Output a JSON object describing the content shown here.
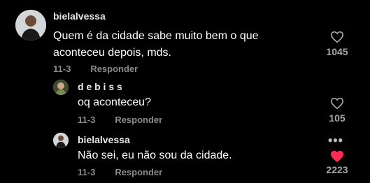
{
  "comments": [
    {
      "username": "bielalvessa",
      "text_line1": "Quem é da cidade sabe muito bem o que",
      "text_line2": "aconteceu depois, mds.",
      "date": "11-3",
      "reply_label": "Responder",
      "likes": "1045",
      "liked": false,
      "avatar_icon": "profile-photo"
    },
    {
      "username": "d e b i s s",
      "text_line1": "oq aconteceu?",
      "date": "11-3",
      "reply_label": "Responder",
      "likes": "105",
      "liked": false,
      "avatar_icon": "profile-photo"
    },
    {
      "username": "bielalvessa",
      "text_line1": "Não sei, eu não sou da cidade.",
      "date": "11-3",
      "reply_label": "Responder",
      "likes": "2223",
      "liked": true,
      "more_label": "•••",
      "avatar_icon": "profile-photo"
    }
  ],
  "colors": {
    "background": "#000000",
    "heart_liked": "#fe2c55",
    "meta_text": "#8a8a8a"
  }
}
